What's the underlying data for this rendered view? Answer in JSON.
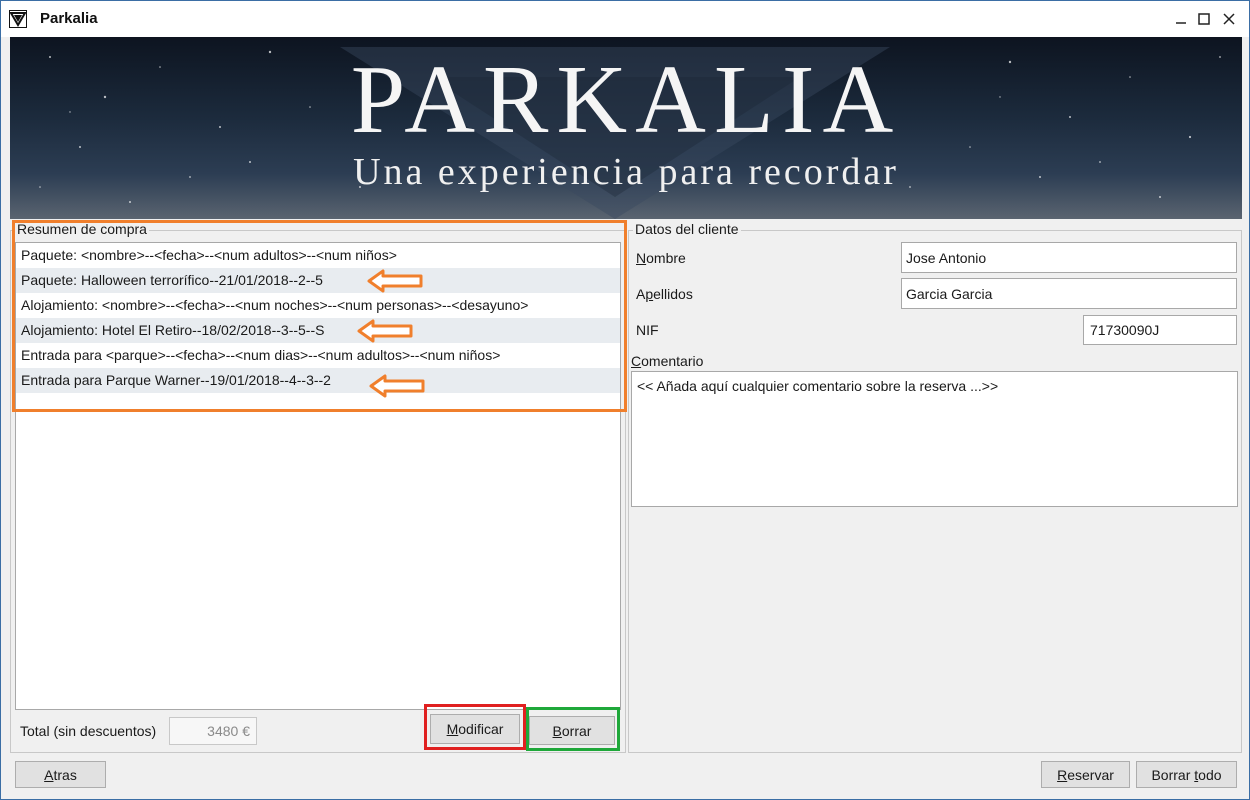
{
  "window": {
    "title": "Parkalia"
  },
  "banner": {
    "title": "PARKALIA",
    "subtitle": "Una experiencia para recordar"
  },
  "summary": {
    "legend": "Resumen de compra",
    "items": [
      "Paquete: <nombre>--<fecha>--<num adultos>--<num niños>",
      "Paquete: Halloween terrorífico--21/01/2018--2--5",
      "Alojamiento: <nombre>--<fecha>--<num noches>--<num personas>--<desayuno>",
      "Alojamiento: Hotel El Retiro--18/02/2018--3--5--S",
      "Entrada para <parque>--<fecha>--<num dias>--<num adultos>--<num niños>",
      "Entrada para Parque Warner--19/01/2018--4--3--2"
    ],
    "total_label": "Total (sin descuentos)",
    "total_value": "3480 €",
    "modify_first": "M",
    "modify_rest": "odificar",
    "delete_first": "B",
    "delete_rest": "orrar"
  },
  "client": {
    "legend": "Datos del cliente",
    "nombre_first": "N",
    "nombre_rest": "ombre",
    "nombre_value": "Jose Antonio",
    "apellidos_pre": "A",
    "apellidos_ul": "p",
    "apellidos_rest": "ellidos",
    "apellidos_value": "Garcia Garcia",
    "nif_label": "NIF",
    "nif_value": "71730090J",
    "comment_first": "C",
    "comment_rest": "omentario",
    "comment_value": "<< Añada aquí cualquier comentario sobre la reserva ...>>"
  },
  "footer": {
    "back_first": "A",
    "back_rest": "tras",
    "reserve_first": "R",
    "reserve_rest": "eservar",
    "clear_pre": "Borrar ",
    "clear_ul": "t",
    "clear_rest": "odo"
  },
  "colors": {
    "highlight_orange": "#f07f2c",
    "highlight_red": "#e02020",
    "highlight_green": "#1fa83a",
    "list_alt_row": "#e8ecf0"
  }
}
